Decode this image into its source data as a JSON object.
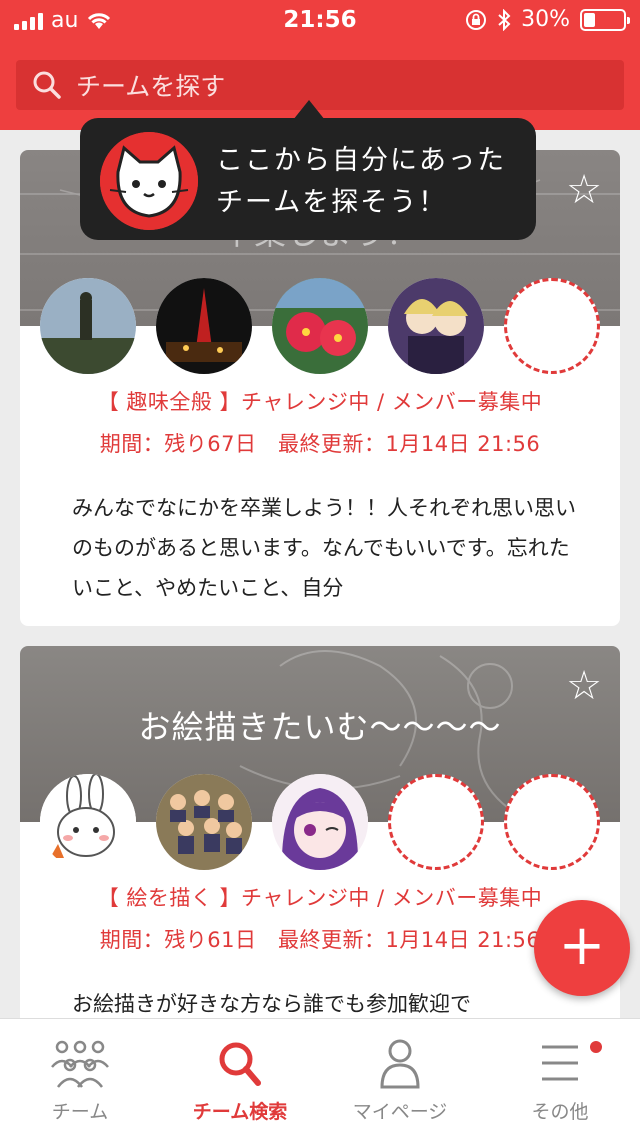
{
  "status_bar": {
    "carrier": "au",
    "time": "21:56",
    "battery": "30%"
  },
  "search": {
    "placeholder": "チームを探す"
  },
  "tooltip": {
    "line1": "ここから自分にあった",
    "line2": "チームを探そう！"
  },
  "cards": [
    {
      "title": "卒業しよう！",
      "meta_line1": "【 趣味全般 】チャレンジ中 / メンバー募集中",
      "meta_line2": "期間：残り67日　最終更新：1月14日 21:56",
      "description": "みんなでなにかを卒業しよう！！人それぞれ思い思いのものがあると思います。なんでもいいです。忘れたいこと、やめたいこと、自分",
      "avatars": [
        "statue",
        "night-tower",
        "hibiscus",
        "anime-girls",
        "empty"
      ]
    },
    {
      "title": "お絵描きたいむ〜〜〜〜",
      "meta_line1": "【 絵を描く 】チャレンジ中 / メンバー募集中",
      "meta_line2": "期間：残り61日　最終更新：1月14日 21:56",
      "description": "お絵描きが好きな方なら誰でも参加歓迎で",
      "avatars": [
        "rabbit",
        "pixel-crowd",
        "purple-hair-girl",
        "empty",
        "empty"
      ]
    }
  ],
  "tabs": [
    {
      "label": "チーム",
      "icon": "people-icon"
    },
    {
      "label": "チーム検索",
      "icon": "search-icon",
      "active": true
    },
    {
      "label": "マイページ",
      "icon": "person-icon"
    },
    {
      "label": "その他",
      "icon": "menu-icon",
      "badge": true
    }
  ],
  "colors": {
    "accent": "#ee3f3f",
    "text": "#222222",
    "inactive": "#888888"
  }
}
